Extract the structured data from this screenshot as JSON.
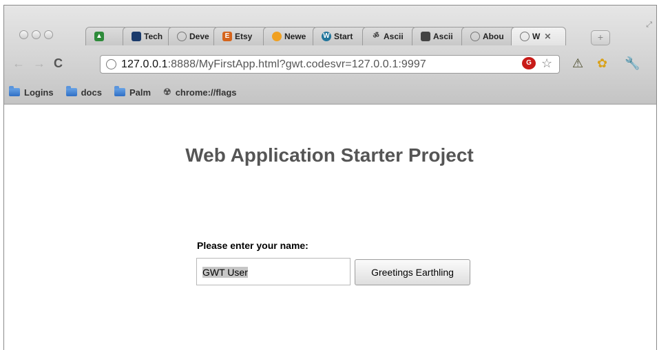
{
  "browser": {
    "tabs": [
      {
        "label": "",
        "icon": "mountain-icon",
        "color": "#2e8b3a"
      },
      {
        "label": "Tech",
        "icon": "tech-icon",
        "color": "#1a3a6b"
      },
      {
        "label": "Deve",
        "icon": "globe-icon",
        "color": "#888888"
      },
      {
        "label": "Etsy",
        "icon": "etsy-icon",
        "color": "#d5641c"
      },
      {
        "label": "Newe",
        "icon": "orb-icon",
        "color": "#f0a020"
      },
      {
        "label": "Start",
        "icon": "wordpress-icon",
        "color": "#21759b"
      },
      {
        "label": "Ascii",
        "icon": "om-icon",
        "color": "#333333"
      },
      {
        "label": "Ascii",
        "icon": "image-icon",
        "color": "#444444"
      },
      {
        "label": "Abou",
        "icon": "globe-icon",
        "color": "#888888"
      },
      {
        "label": "W",
        "icon": "globe-icon",
        "color": "#888888",
        "active": true
      }
    ],
    "url_host": "127.0.0.1",
    "url_rest": ":8888/MyFirstApp.html?gwt.codesvr=127.0.0.1:9997",
    "bookmarks": [
      {
        "label": "Logins",
        "icon": "folder-icon"
      },
      {
        "label": "docs",
        "icon": "folder-icon"
      },
      {
        "label": "Palm",
        "icon": "folder-icon"
      },
      {
        "label": "chrome://flags",
        "icon": "radiation-icon"
      }
    ]
  },
  "page": {
    "title": "Web Application Starter Project",
    "name_label": "Please enter your name:",
    "name_value": "GWT User",
    "button_label": "Greetings Earthling"
  }
}
